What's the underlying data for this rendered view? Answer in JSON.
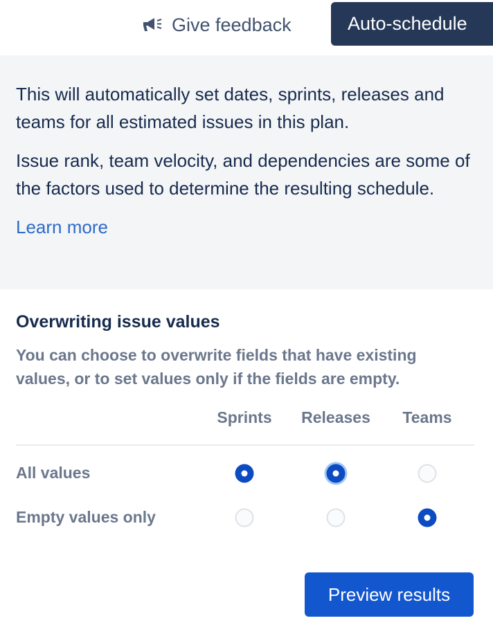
{
  "header": {
    "feedback_label": "Give feedback",
    "feedback_icon": "megaphone-icon",
    "auto_schedule_label": "Auto-schedule"
  },
  "info": {
    "paragraph1": "This will automatically set dates, sprints, releases and teams for all estimated issues in this plan.",
    "paragraph2": "Issue rank, team velocity, and dependencies are some of the factors used to determine the resulting schedule.",
    "learn_more": "Learn more"
  },
  "overwrite": {
    "title": "Overwriting issue values",
    "description": "You can choose to overwrite fields that have existing values, or to set values only if the fields are empty.",
    "columns": [
      "Sprints",
      "Releases",
      "Teams"
    ],
    "rows": [
      {
        "label": "All values",
        "selected": [
          true,
          true,
          false
        ]
      },
      {
        "label": "Empty values only",
        "selected": [
          false,
          false,
          true
        ]
      }
    ]
  },
  "footer": {
    "preview_label": "Preview results"
  },
  "colors": {
    "primary_dark": "#253858",
    "primary_blue": "#1357cf",
    "radio_selected": "#0c4bc1",
    "link": "#2e6ac7",
    "panel_bg": "#f4f5f7",
    "muted_text": "#6b778c"
  }
}
